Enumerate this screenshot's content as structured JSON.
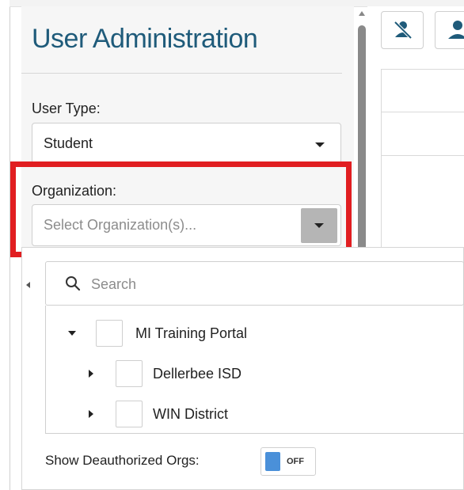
{
  "panel": {
    "title": "User Administration",
    "user_type_label": "User Type:",
    "user_type_value": "Student",
    "organization_label": "Organization:",
    "organization_placeholder": "Select Organization(s)..."
  },
  "toolbar": {
    "icons": [
      "user-off-icon",
      "user-icon"
    ]
  },
  "org_dropdown": {
    "search_placeholder": "Search",
    "tree": [
      {
        "label": "MI Training Portal",
        "expanded": true,
        "level": 0
      },
      {
        "label": "Dellerbee ISD",
        "expanded": false,
        "level": 1
      },
      {
        "label": "WIN District",
        "expanded": false,
        "level": 1
      }
    ],
    "show_deauthorized_label": "Show Deauthorized Orgs:",
    "toggle_state": "OFF"
  },
  "colors": {
    "title": "#1f5b7a",
    "highlight": "#e11e21",
    "toggle_knob": "#4a90d9",
    "dropdown_button": "#b5b5b5"
  }
}
